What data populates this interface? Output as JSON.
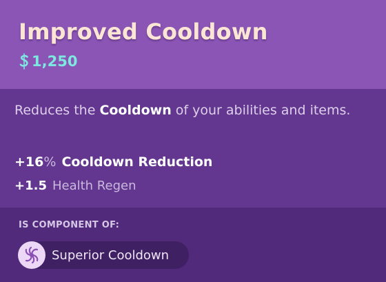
{
  "item": {
    "title": "Improved Cooldown",
    "price": "1,250",
    "price_icon": "souls-currency-icon"
  },
  "description": {
    "part1": "Reduces the ",
    "highlight": "Cooldown",
    "part2": " of your abilities and items."
  },
  "stats": [
    {
      "value": "+16",
      "unit": "%",
      "name": "Cooldown Reduction"
    },
    {
      "value": "+1.5",
      "unit": "",
      "name": "Health Regen"
    }
  ],
  "component_of": {
    "label": "IS COMPONENT OF:",
    "items": [
      {
        "name": "Superior Cooldown",
        "icon": "cooldown-swirl-icon"
      }
    ]
  },
  "colors": {
    "header_bg": "#8a55b5",
    "body_bg": "#63378f",
    "footer_bg": "#522a7c",
    "title": "#fbe6d5",
    "price": "#7ee7e0"
  }
}
